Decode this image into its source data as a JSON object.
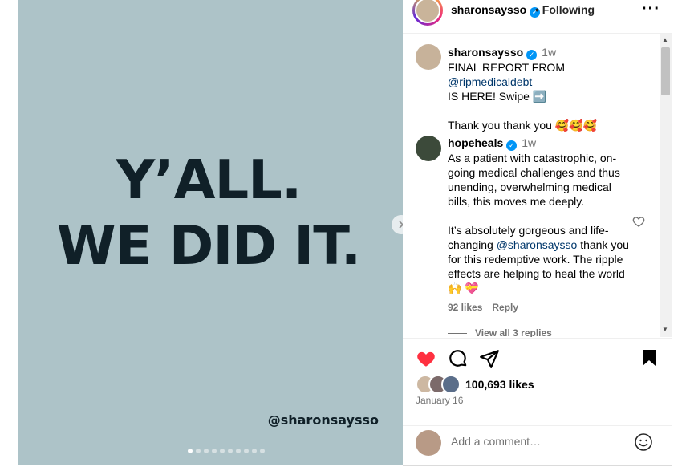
{
  "media": {
    "headline_line1": "Y’ALL.",
    "headline_line2": "WE DID IT.",
    "watermark": "@sharonsaysso",
    "slide_count": 10,
    "active_slide": 1,
    "background": "#adc3c8"
  },
  "header": {
    "username": "sharonsaysso",
    "following_label": "• Following"
  },
  "comments": [
    {
      "username": "sharonsaysso",
      "time": "1w",
      "line1_prefix": "FINAL REPORT FROM ",
      "line1_mention": "@ripmedicaldebt",
      "line2": "IS HERE! Swipe ➡️",
      "line3": "Thank you thank you 🥰🥰🥰"
    },
    {
      "username": "hopeheals",
      "time": "1w",
      "para1": "As a patient with catastrophic, on-going medical challenges and thus unending, overwhelming medical bills, this moves me deeply.",
      "para2_prefix": "It’s absolutely gorgeous and life-changing ",
      "para2_mention": "@sharonsaysso",
      "para2_suffix": " thank you for this redemptive work. The ripple effects are helping to heal the world 🙌 💝",
      "likes": "92 likes",
      "reply_label": "Reply",
      "view_replies": "View all 3 replies"
    }
  ],
  "actions": {
    "likes": "100,693 likes",
    "date": "January 16"
  },
  "add_comment": {
    "placeholder": "Add a comment…"
  },
  "colors": {
    "like_red": "#ff3040",
    "link_blue": "#00376b",
    "verified_blue": "#0095f6"
  }
}
